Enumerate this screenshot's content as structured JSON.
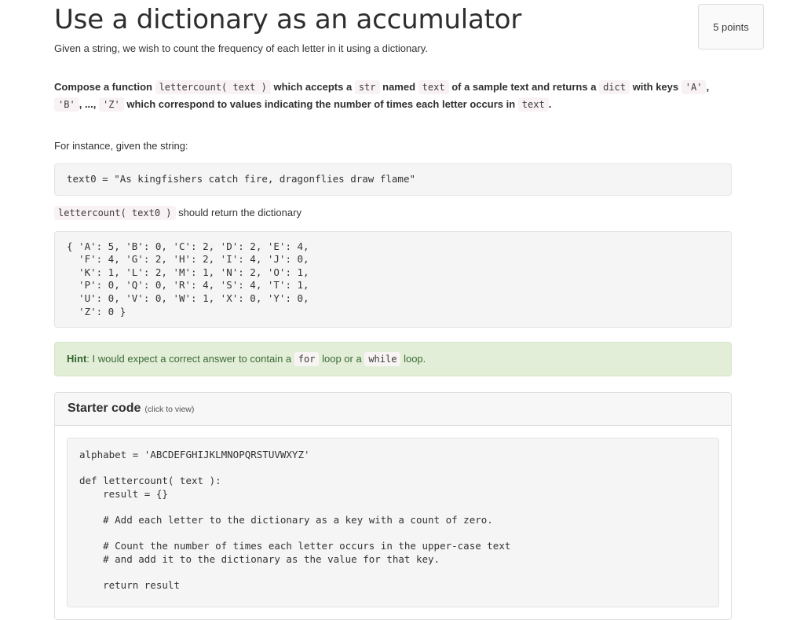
{
  "header": {
    "title": "Use a dictionary as an accumulator",
    "subtitle": "Given a string, we wish to count the frequency of each letter in it using a dictionary.",
    "points_badge": "5 points"
  },
  "statement": {
    "part1": "Compose a function",
    "code1": "lettercount( text )",
    "part2": "which accepts a",
    "code2": "str",
    "part3": "named",
    "code3": "text",
    "part4": "of a sample text and returns a",
    "code4": "dict",
    "part5": "with keys",
    "code5": "'A'",
    "comma1": ",",
    "code6": "'B'",
    "comma2": ",",
    "part6": "...,",
    "code7": "'Z'",
    "part7": "which correspond to values indicating the number of times each letter occurs in",
    "code8": "text",
    "period": "."
  },
  "example": {
    "for_instance": "For instance, given the string:",
    "sample_code": "text0 = \"As kingfishers catch fire, dragonflies draw flame\"",
    "return_code": "lettercount( text0 )",
    "return_text": "should return the dictionary",
    "dict_output": "{ 'A': 5, 'B': 0, 'C': 2, 'D': 2, 'E': 4,\n  'F': 4, 'G': 2, 'H': 2, 'I': 4, 'J': 0,\n  'K': 1, 'L': 2, 'M': 1, 'N': 2, 'O': 1,\n  'P': 0, 'Q': 0, 'R': 4, 'S': 4, 'T': 1,\n  'U': 0, 'V': 0, 'W': 1, 'X': 0, 'Y': 0,\n  'Z': 0 }"
  },
  "hint": {
    "label": "Hint",
    "colon": ":",
    "text1": "I would expect a correct answer to contain a",
    "code1": "for",
    "text2": "loop or a",
    "code2": "while",
    "text3": "loop."
  },
  "starter_panel": {
    "title": "Starter code",
    "note": "(click to view)",
    "code": "alphabet = 'ABCDEFGHIJKLMNOPQRSTUVWXYZ'\n\ndef lettercount( text ):\n    result = {}\n\n    # Add each letter to the dictionary as a key with a count of zero.\n\n    # Count the number of times each letter occurs in the upper-case text\n    # and add it to the dictionary as the value for that key.\n\n    return result"
  },
  "colors": {
    "inline_code_bg": "#f9f2f4",
    "code_block_bg": "#f5f5f5",
    "hint_bg": "#e3eed8",
    "hint_text": "#3b6b35",
    "panel_header_bg": "#f7f7f7"
  }
}
